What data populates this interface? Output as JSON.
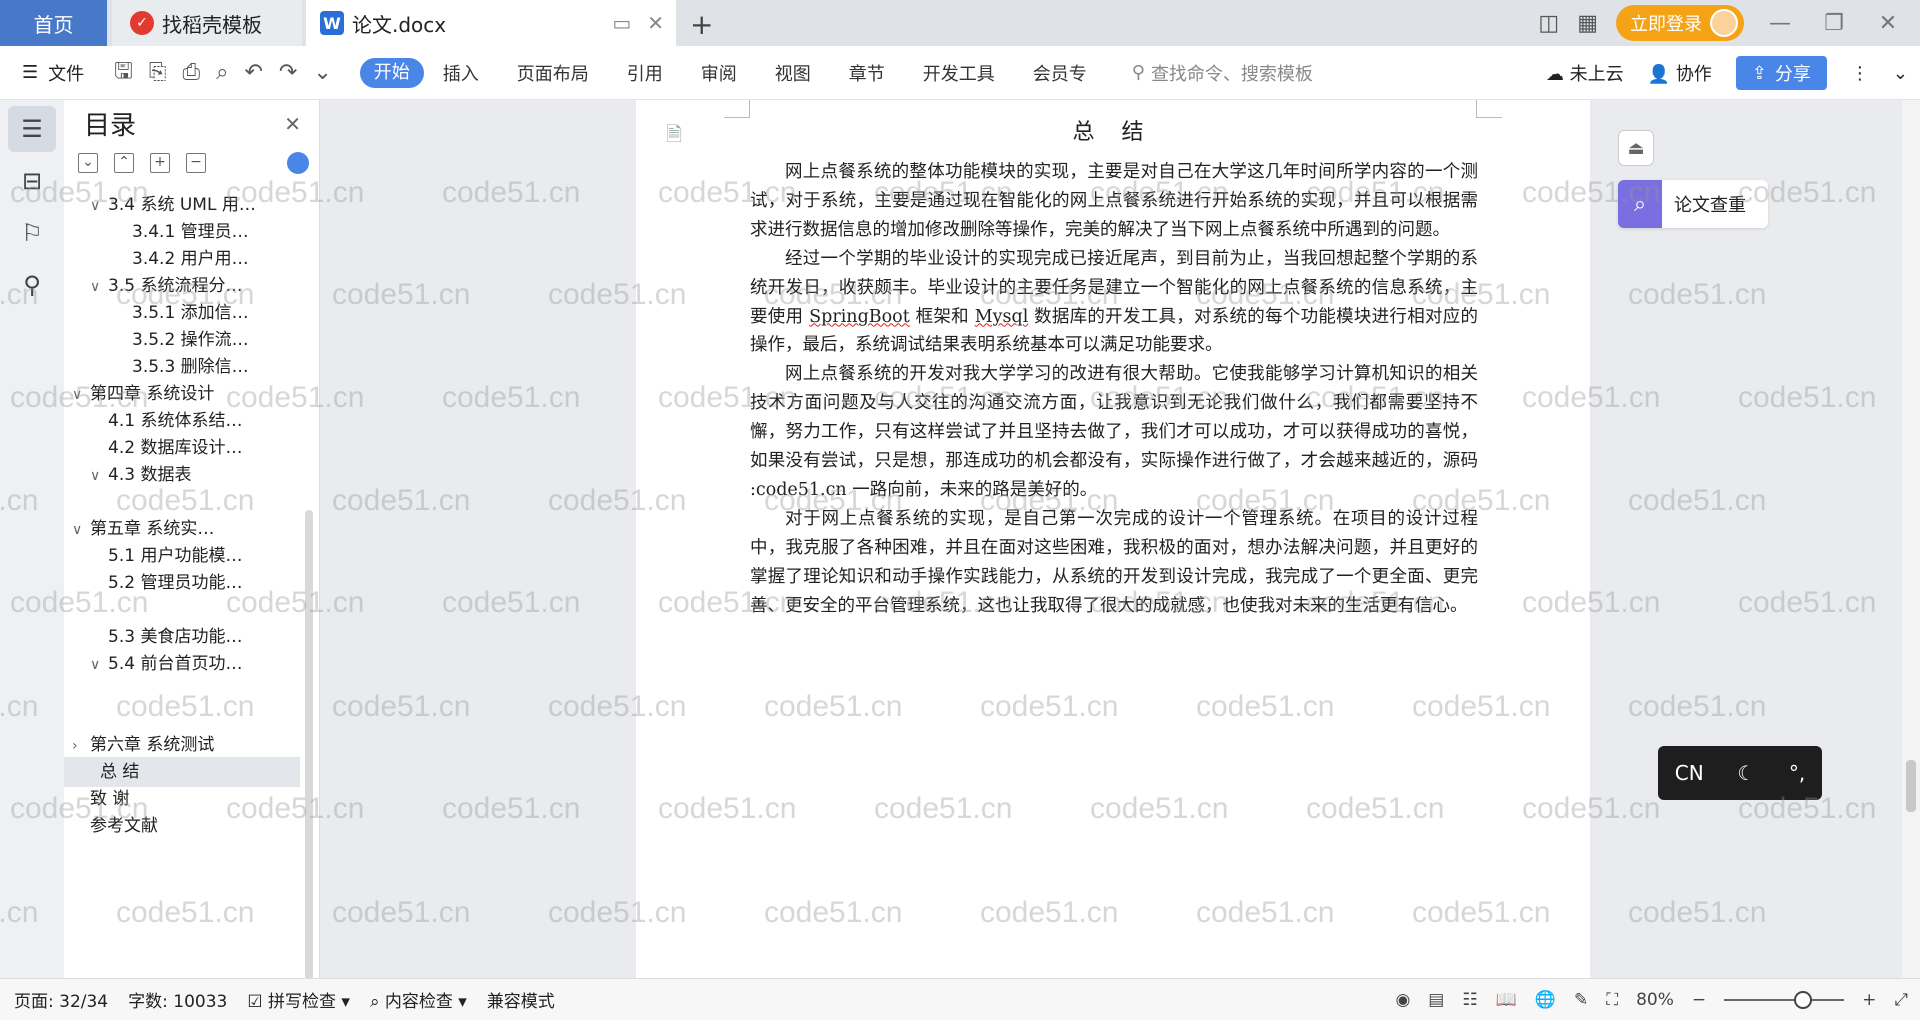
{
  "titlebar": {
    "tab_home": "首页",
    "tab_template": "找稻壳模板",
    "tab_doc": "论文.docx",
    "new_tab": "+",
    "login": "立即登录"
  },
  "ribbon": {
    "file": "文件",
    "tabs": [
      "开始",
      "插入",
      "页面布局",
      "引用",
      "审阅",
      "视图",
      "章节",
      "开发工具",
      "会员专"
    ],
    "search_placeholder": "查找命令、搜索模板",
    "cloud": "未上云",
    "collab": "协作",
    "share": "分享"
  },
  "toc": {
    "title": "目录",
    "items": [
      {
        "text": "3.4 系统 UML 用…",
        "caret": "∨"
      },
      {
        "text": "3.4.1 管理员…",
        "caret": ""
      },
      {
        "text": "3.4.2 用户用…",
        "caret": ""
      },
      {
        "text": "3.5 系统流程分…",
        "caret": "∨"
      },
      {
        "text": "3.5.1 添加信…",
        "caret": ""
      },
      {
        "text": "3.5.2 操作流…",
        "caret": ""
      },
      {
        "text": "3.5.3 删除信…",
        "caret": ""
      },
      {
        "text": "第四章  系统设计",
        "caret": "∨"
      },
      {
        "text": "4.1  系统体系结…",
        "caret": ""
      },
      {
        "text": "4.2  数据库设计…",
        "caret": ""
      },
      {
        "text": "4.3  数据表",
        "caret": "∨"
      },
      {
        "text": "第五章  系统实…",
        "caret": "∨"
      },
      {
        "text": "5.1 用户功能模…",
        "caret": ""
      },
      {
        "text": "5.2 管理员功能…",
        "caret": ""
      },
      {
        "text": "5.3 美食店功能…",
        "caret": ""
      },
      {
        "text": "5.4 前台首页功…",
        "caret": "∨"
      },
      {
        "text": "第六章    系统测试",
        "caret": "›"
      },
      {
        "text": "总    结",
        "caret": ""
      },
      {
        "text": "致    谢",
        "caret": ""
      },
      {
        "text": "参考文献",
        "caret": ""
      }
    ]
  },
  "document": {
    "title": "总 结",
    "p1": "网上点餐系统的整体功能模块的实现，主要是对自己在大学这几年时间所学内容的一个测试，对于系统，主要是通过现在智能化的网上点餐系统进行开始系统的实现，并且可以根据需求进行数据信息的增加修改删除等操作，完美的解决了当下网上点餐系统中所遇到的问题。",
    "p2_a": "经过一个学期的毕业设计的实现完成已接近尾声，到目前为止，当我回想起整个学期的系统开发日，收获颇丰。毕业设计的主要任务是建立一个智能化的网上点餐系统的信息系统，主要使用 ",
    "p2_springboot": "SpringBoot",
    "p2_b": " 框架和 ",
    "p2_mysql": "Mysql",
    "p2_c": " 数据库的开发工具，对系统的每个功能模块进行相对应的操作，最后，系统调试结果表明系统基本可以满足功能要求。",
    "p3": "网上点餐系统的开发对我大学学习的改进有很大帮助。它使我能够学习计算机知识的相关技术方面问题及与人交往的沟通交流方面，让我意识到无论我们做什么，我们都需要坚持不懈，努力工作，只有这样尝试了并且坚持去做了，我们才可以成功，才可以获得成功的喜悦，如果没有尝试，只是想，那连成功的机会都没有，实际操作进行做了，才会越来越近的，源码 :code51.cn 一路向前，未来的路是美好的。",
    "p4": "对于网上点餐系统的实现，是自己第一次完成的设计一个管理系统。在项目的设计过程中，我克服了各种困难，并且在面对这些困难，我积极的面对，想办法解决问题，并且更好的掌握了理论知识和动手操作实践能力，从系统的开发到设计完成，我完成了一个更全面、更完善、更安全的平台管理系统，这也让我取得了很大的成就感，也使我对未来的生活更有信心。"
  },
  "right_panel": {
    "check": "论文查重",
    "ime": "CN"
  },
  "watermark": "code51.cn",
  "statusbar": {
    "page": "页面: 32/34",
    "words": "字数: 10033",
    "spell": "拼写检查",
    "content": "内容检查",
    "compat": "兼容模式",
    "zoom": "80%"
  }
}
